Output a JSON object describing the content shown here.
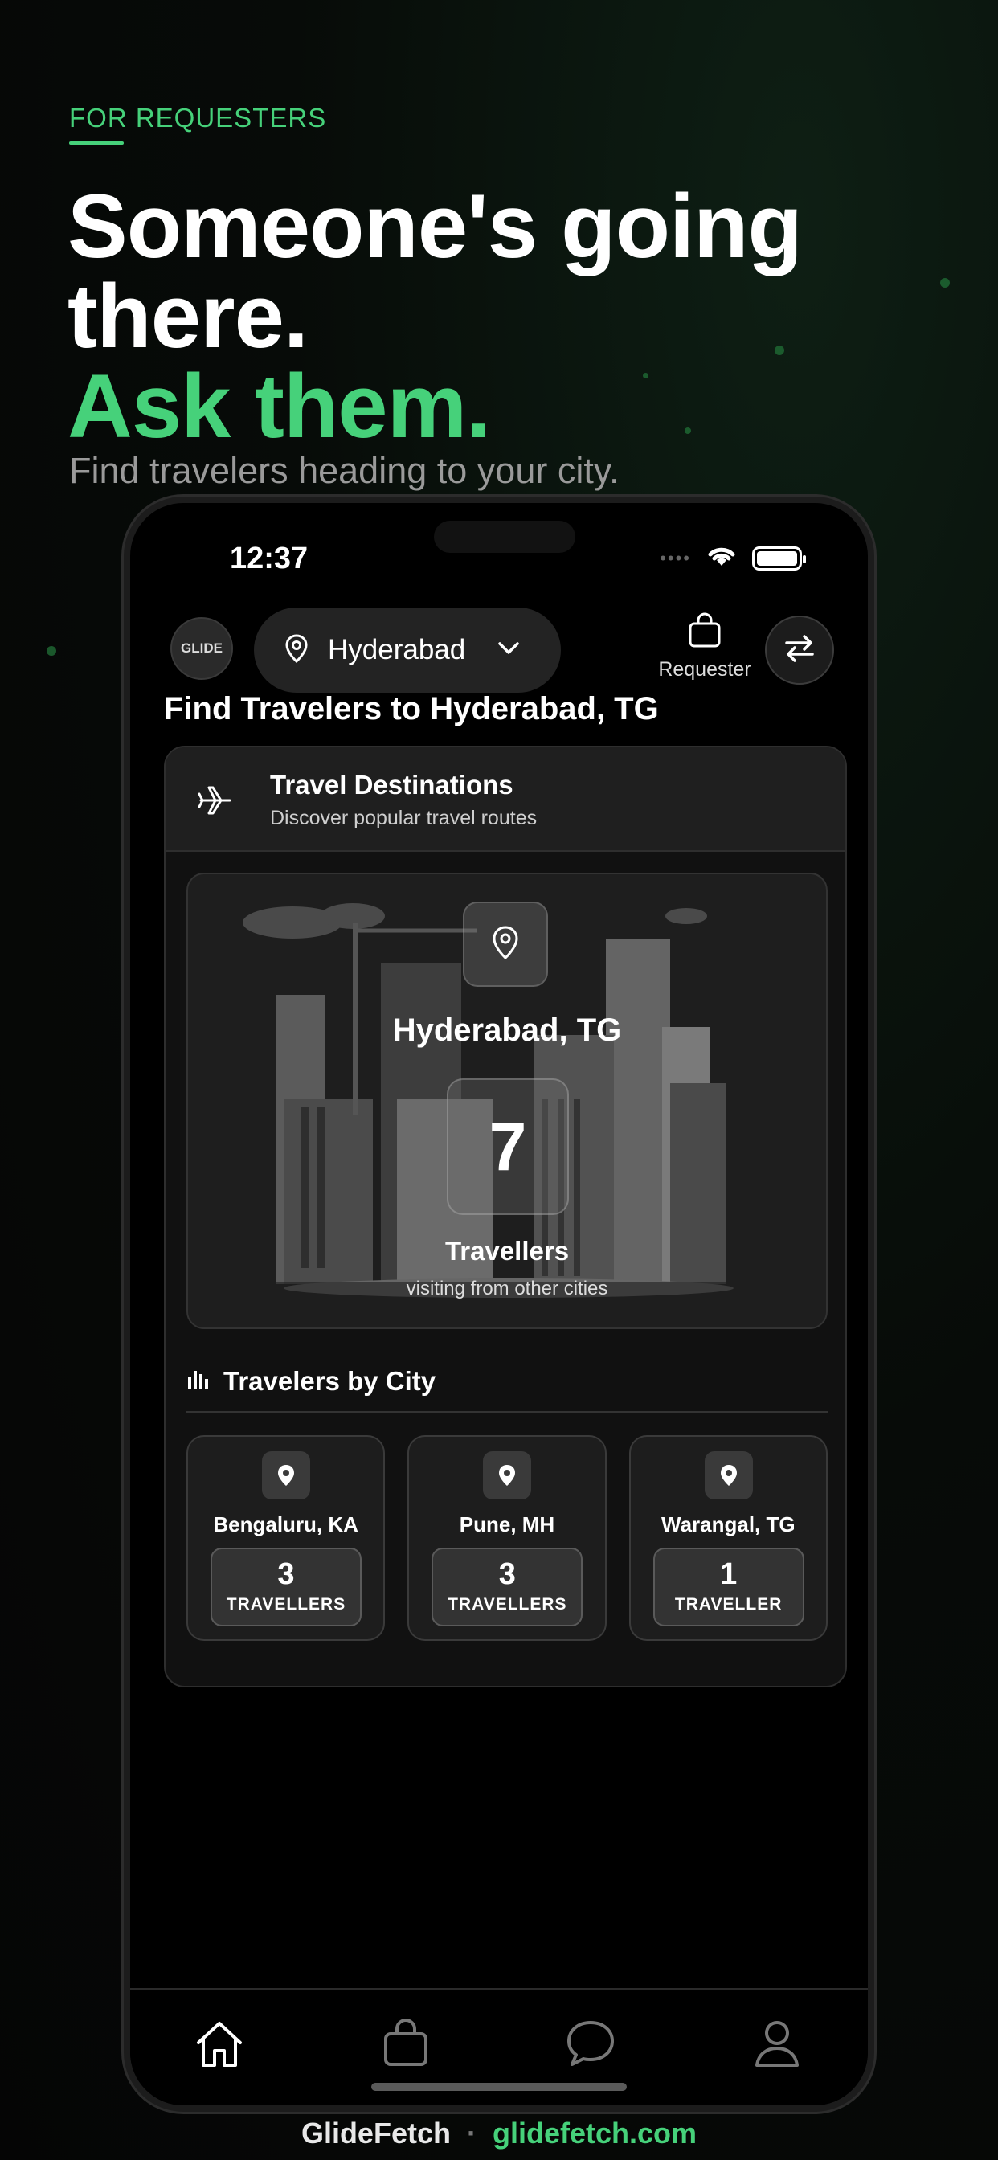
{
  "marketing": {
    "eyebrow": "FOR REQUESTERS",
    "headline_line1": "Someone's going",
    "headline_line2": "there.",
    "headline_accent": "Ask them.",
    "subhead": "Find travelers heading to your city.",
    "accent_color": "#46d17a"
  },
  "status_bar": {
    "time": "12:37",
    "icons": [
      "signal-icon",
      "wifi-icon",
      "battery-icon"
    ]
  },
  "topbar": {
    "logo_text": "GLIDE",
    "location_selector": "Hyderabad",
    "role_label": "Requester",
    "icons": [
      "pin-icon",
      "chevron-down-icon",
      "bag-icon",
      "swap-icon"
    ]
  },
  "page": {
    "title": "Find Travelers to Hyderabad, TG"
  },
  "destinations_card": {
    "title": "Travel Destinations",
    "subtitle": "Discover popular travel routes",
    "icon": "plane-icon"
  },
  "hero": {
    "city": "Hyderabad, TG",
    "count": "7",
    "label": "Travellers",
    "sublabel": "visiting from other cities"
  },
  "by_city": {
    "title": "Travelers by City",
    "icon": "bar-chart-icon",
    "cities": [
      {
        "name": "Bengaluru, KA",
        "count": "3",
        "unit": "TRAVELLERS"
      },
      {
        "name": "Pune, MH",
        "count": "3",
        "unit": "TRAVELLERS"
      },
      {
        "name": "Warangal, TG",
        "count": "1",
        "unit": "TRAVELLER"
      }
    ]
  },
  "tabbar": {
    "tabs": [
      "home-icon",
      "bag-icon",
      "chat-icon",
      "profile-icon"
    ],
    "active": "home-icon"
  },
  "footer": {
    "brand": "GlideFetch",
    "separator": "·",
    "url": "glidefetch.com"
  }
}
